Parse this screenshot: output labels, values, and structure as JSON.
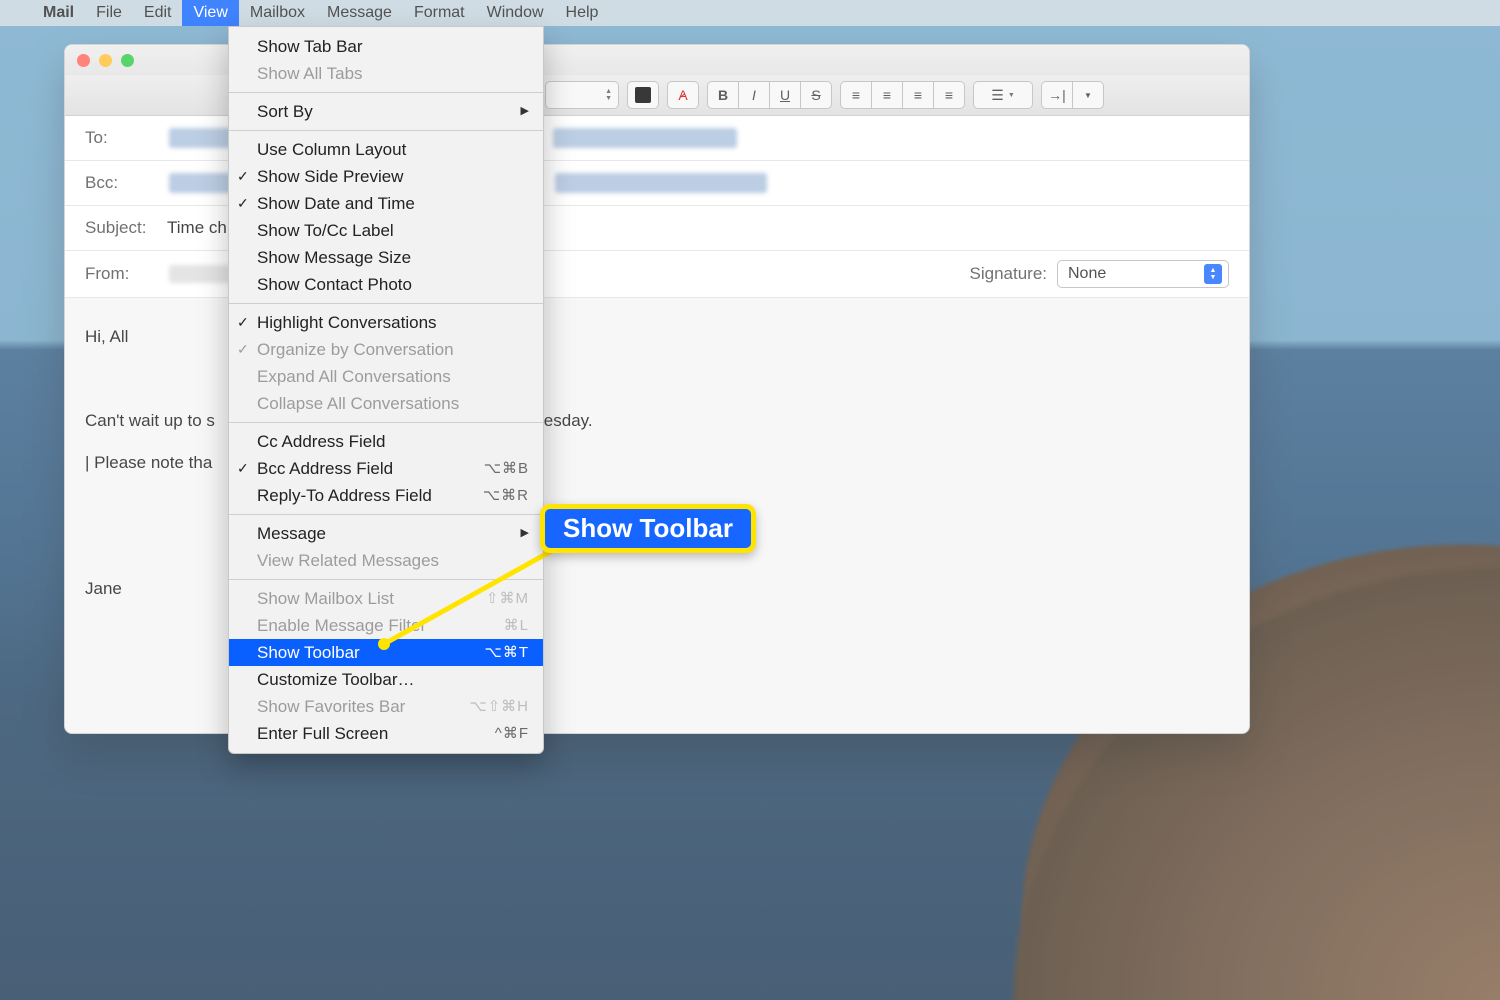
{
  "menubar": {
    "app": "Mail",
    "items": [
      "File",
      "Edit",
      "View",
      "Mailbox",
      "Message",
      "Format",
      "Window",
      "Help"
    ],
    "active": "View"
  },
  "toolbar": {
    "font_color_swatch": "#000000",
    "bold": "B",
    "italic": "I",
    "underline": "U",
    "strike": "S",
    "align": [
      "left",
      "center",
      "right",
      "justify"
    ],
    "list_label": "list",
    "indent_label": "indent"
  },
  "fields": {
    "to_label": "To:",
    "bcc_label": "Bcc:",
    "subject_label": "Subject:",
    "subject_value": "Time ch",
    "from_label": "From:",
    "signature_label": "Signature:",
    "signature_value": "None"
  },
  "body": {
    "line1": "Hi, All",
    "line2_a": "Can't wait up to s",
    "line2_b": "dnesday.",
    "line3": "| Please note tha",
    "line4": "Jane"
  },
  "view_menu": {
    "items": [
      {
        "label": "Show Tab Bar"
      },
      {
        "label": "Show All Tabs",
        "disabled": true
      },
      {
        "sep": true
      },
      {
        "label": "Sort By",
        "submenu": true
      },
      {
        "sep": true
      },
      {
        "label": "Use Column Layout"
      },
      {
        "label": "Show Side Preview",
        "checked": true
      },
      {
        "label": "Show Date and Time",
        "checked": true
      },
      {
        "label": "Show To/Cc Label"
      },
      {
        "label": "Show Message Size"
      },
      {
        "label": "Show Contact Photo"
      },
      {
        "sep": true
      },
      {
        "label": "Highlight Conversations",
        "checked": true
      },
      {
        "label": "Organize by Conversation",
        "checked": true,
        "disabled": true
      },
      {
        "label": "Expand All Conversations",
        "disabled": true
      },
      {
        "label": "Collapse All Conversations",
        "disabled": true
      },
      {
        "sep": true
      },
      {
        "label": "Cc Address Field"
      },
      {
        "label": "Bcc Address Field",
        "checked": true,
        "shortcut": "⌥⌘B"
      },
      {
        "label": "Reply-To Address Field",
        "shortcut": "⌥⌘R"
      },
      {
        "sep": true
      },
      {
        "label": "Message",
        "submenu": true
      },
      {
        "label": "View Related Messages",
        "disabled": true
      },
      {
        "sep": true
      },
      {
        "label": "Show Mailbox List",
        "disabled": true,
        "shortcut": "⇧⌘M"
      },
      {
        "label": "Enable Message Filter",
        "disabled": true,
        "shortcut": "⌘L"
      },
      {
        "label": "Show Toolbar",
        "highlighted": true,
        "shortcut": "⌥⌘T"
      },
      {
        "label": "Customize Toolbar…"
      },
      {
        "label": "Show Favorites Bar",
        "disabled": true,
        "shortcut": "⌥⇧⌘H"
      },
      {
        "label": "Enter Full Screen",
        "shortcut": "^⌘F"
      }
    ]
  },
  "callout": {
    "text": "Show Toolbar"
  }
}
